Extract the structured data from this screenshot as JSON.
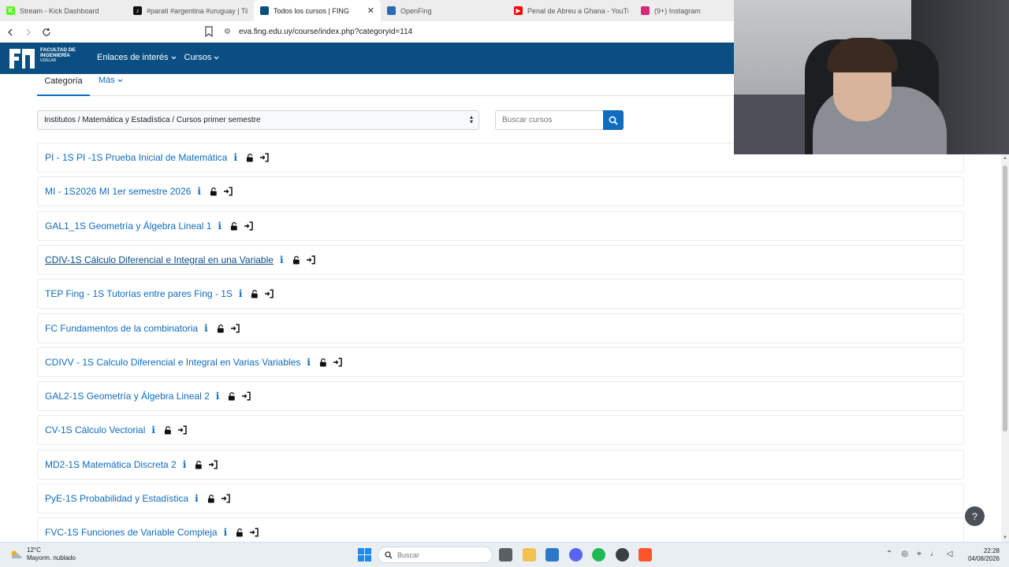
{
  "browser": {
    "tabs": [
      {
        "label": "Stream - Kick Dashboard",
        "icon": "kick-icon",
        "color": "#53fc18",
        "glyph": "K",
        "active": false
      },
      {
        "label": "#parati #argentina #uruguay | TikTok",
        "icon": "tiktok-icon",
        "color": "#111111",
        "glyph": "♪",
        "active": false
      },
      {
        "label": "Todos los cursos | FING",
        "icon": "fing-icon",
        "color": "#0b4f82",
        "glyph": "",
        "active": true
      },
      {
        "label": "OpenFing",
        "icon": "openfing-icon",
        "color": "#2b6cb0",
        "glyph": "",
        "active": false
      },
      {
        "label": "Penal de Abreu a Ghana - YouTube",
        "icon": "youtube-icon",
        "color": "#ff0000",
        "glyph": "▶",
        "active": false
      },
      {
        "label": "(9+) Instagram",
        "icon": "instagram-icon",
        "color": "#d62976",
        "glyph": "",
        "active": false
      }
    ],
    "close_glyph": "✕",
    "url": "eva.fing.edu.uy/course/index.php?categoryid=114"
  },
  "site": {
    "logo_line1": "FACULTAD DE",
    "logo_line2": "INGENIERÍA",
    "logo_line3": "UDELAR",
    "menu": [
      {
        "label": "Enlaces de interés"
      },
      {
        "label": "Cursos"
      }
    ],
    "brand_color": "#0b4f82"
  },
  "secondary_nav": {
    "tabs": [
      {
        "label": "Categoría"
      },
      {
        "label": "Más"
      }
    ]
  },
  "category_select": {
    "value": "Institutos / Matemática y Estadística / Cursos primer semestre"
  },
  "course_search": {
    "placeholder": "Buscar cursos"
  },
  "courses": [
    {
      "name": "PI - 1S PI -1S Prueba Inicial de Matemática",
      "hover": false
    },
    {
      "name": "MI - 1S2026 MI 1er semestre 2026",
      "hover": false
    },
    {
      "name": "GAL1_1S Geometría y Álgebra Lineal 1",
      "hover": false
    },
    {
      "name": "CDIV-1S Cálculo Diferencial e Integral en una Variable",
      "hover": true
    },
    {
      "name": "TEP Fing - 1S Tutorías entre pares Fing - 1S",
      "hover": false
    },
    {
      "name": "FC Fundamentos de la combinatoria",
      "hover": false
    },
    {
      "name": "CDIVV - 1S Calculo Diferencial e Integral en Varias Variables",
      "hover": false
    },
    {
      "name": "GAL2-1S Geometría y Álgebra Lineal 2",
      "hover": false
    },
    {
      "name": "CV-1S Cálculo Vectorial",
      "hover": false
    },
    {
      "name": "MD2-1S Matemática Discreta 2",
      "hover": false
    },
    {
      "name": "PyE-1S Probabilidad y Estadística",
      "hover": false
    },
    {
      "name": "FVC-1S Funciones de Variable Compleja",
      "hover": false
    }
  ],
  "course_info_glyph": "i",
  "help_glyph": "?",
  "taskbar": {
    "weather_temp": "12°C",
    "weather_desc": "Mayorm. nublado",
    "search_placeholder": "Buscar",
    "time": "22:28",
    "date": "04/08/2026"
  }
}
